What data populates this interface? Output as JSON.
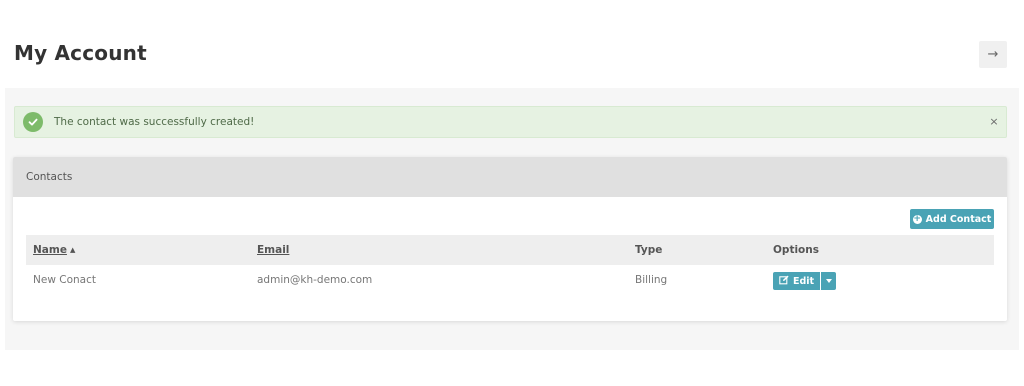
{
  "header": {
    "title": "My Account",
    "action_glyph": "→",
    "action_icon": "arrow-right-icon"
  },
  "alert": {
    "message": "The contact was successfully created!",
    "close_glyph": "×",
    "icon": "check-circle-icon",
    "color": "#7dbb6a"
  },
  "panel": {
    "title": "Contacts",
    "add_button_label": "Add Contact",
    "add_button_icon": "plus-circle-icon",
    "accent": "#4aa3b5"
  },
  "table": {
    "columns": [
      {
        "label": "Name",
        "sortable": true,
        "sort": "asc"
      },
      {
        "label": "Email",
        "sortable": true
      },
      {
        "label": "Type",
        "sortable": false
      },
      {
        "label": "Options",
        "sortable": false
      }
    ],
    "rows": [
      {
        "name": "New Conact",
        "email": "admin@kh-demo.com",
        "type": "Billing",
        "edit_label": "Edit",
        "edit_icon": "edit-icon",
        "caret_icon": "caret-down-icon"
      }
    ]
  }
}
